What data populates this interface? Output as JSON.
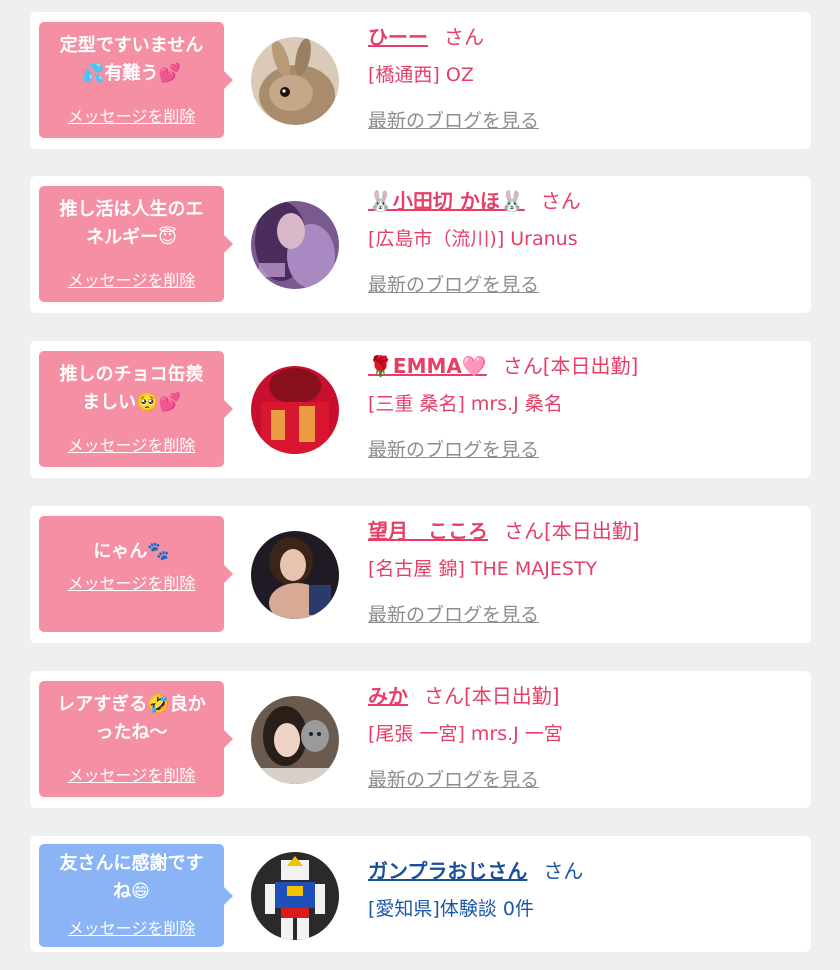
{
  "cards": [
    {
      "message": "定型ですいません\n💦有難う💕",
      "delete_label": "メッセージを削除",
      "name": "ひーー",
      "honorific": "さん",
      "shop": "[橋通西] OZ",
      "blog_link": "最新のブログを見る",
      "bubble_color": "#f58fa3",
      "avatar": "rabbit-photo"
    },
    {
      "message": "推し活は人生のエ\nネルギー😇",
      "delete_label": "メッセージを削除",
      "name": "🐰小田切 かほ🐰",
      "honorific": "さん",
      "shop": "[広島市（流川)] Uranus",
      "blog_link": "最新のブログを見る",
      "bubble_color": "#f58fa3",
      "avatar": "woman-purple-photo"
    },
    {
      "message": "推しのチョコ缶羨\nましい🥺💕",
      "delete_label": "メッセージを削除",
      "name": "🌹EMMA🩷",
      "honorific": "さん[本日出勤]",
      "shop": "[三重 桑名] mrs.J 桑名",
      "blog_link": "最新のブログを見る",
      "bubble_color": "#f58fa3",
      "avatar": "red-shirt-photo"
    },
    {
      "message": "にゃん🐾",
      "delete_label": "メッセージを削除",
      "name": "望月　こころ",
      "honorific": "さん[本日出勤]",
      "shop": "[名古屋 錦] THE MAJESTY",
      "blog_link": "最新のブログを見る",
      "bubble_color": "#f58fa3",
      "avatar": "woman-dark-photo"
    },
    {
      "message": "レアすぎる🤣良か\nったね〜",
      "delete_label": "メッセージを削除",
      "name": "みか",
      "honorific": "さん[本日出勤]",
      "shop": "[尾張 一宮] mrs.J 一宮",
      "blog_link": "最新のブログを見る",
      "bubble_color": "#f58fa3",
      "avatar": "woman-cat-photo"
    },
    {
      "message": "友さんに感謝です\nね😄",
      "delete_label": "メッセージを削除",
      "name": "ガンプラおじさん",
      "honorific": "さん",
      "shop": "[愛知県]体験談 0件",
      "blog_link": "",
      "bubble_color": "#8ab4f5",
      "avatar": "robot-figure-photo"
    }
  ]
}
